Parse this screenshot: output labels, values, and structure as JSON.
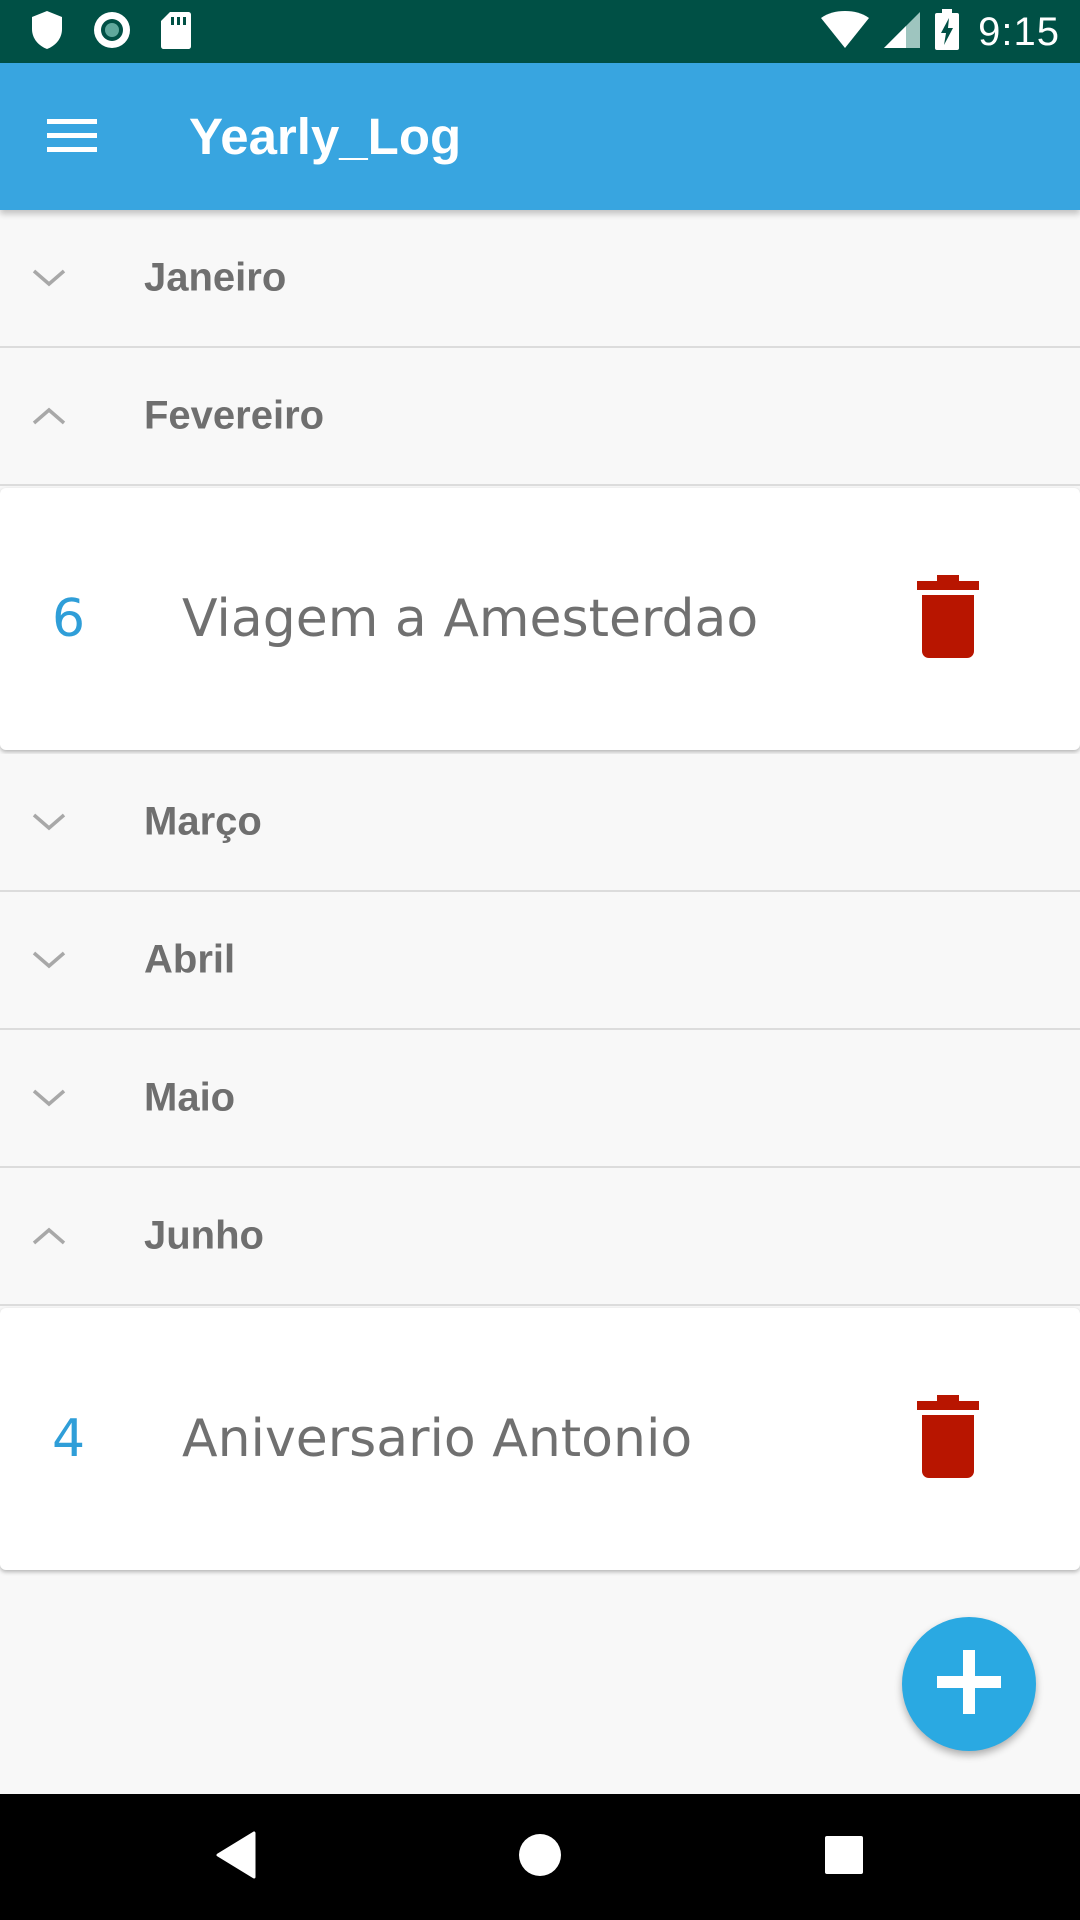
{
  "status_bar": {
    "time": "9:15",
    "icons": [
      "shield-icon",
      "record-icon",
      "sd-card-icon",
      "wifi-icon",
      "signal-icon",
      "battery-charging-icon"
    ]
  },
  "app_bar": {
    "title": "Yearly_Log",
    "menu_icon": "hamburger-menu-icon"
  },
  "months": [
    {
      "label": "Janeiro",
      "expanded": false,
      "events": []
    },
    {
      "label": "Fevereiro",
      "expanded": true,
      "events": [
        {
          "day": "6",
          "title": "Viagem a Amesterdao"
        }
      ]
    },
    {
      "label": "Março",
      "expanded": false,
      "events": []
    },
    {
      "label": "Abril",
      "expanded": false,
      "events": []
    },
    {
      "label": "Maio",
      "expanded": false,
      "events": []
    },
    {
      "label": "Junho",
      "expanded": true,
      "events": [
        {
          "day": "4",
          "title": "Aniversario Antonio"
        }
      ]
    }
  ],
  "fab": {
    "icon": "plus-icon"
  },
  "nav_bar": {
    "icons": [
      "back-icon",
      "home-icon",
      "recents-icon"
    ]
  },
  "colors": {
    "status_bar": "#005045",
    "app_bar": "#38a5e0",
    "day_number": "#2f9ed8",
    "delete_icon": "#b81500",
    "fab": "#2aa9e2",
    "month_text": "#6f6f6f"
  }
}
